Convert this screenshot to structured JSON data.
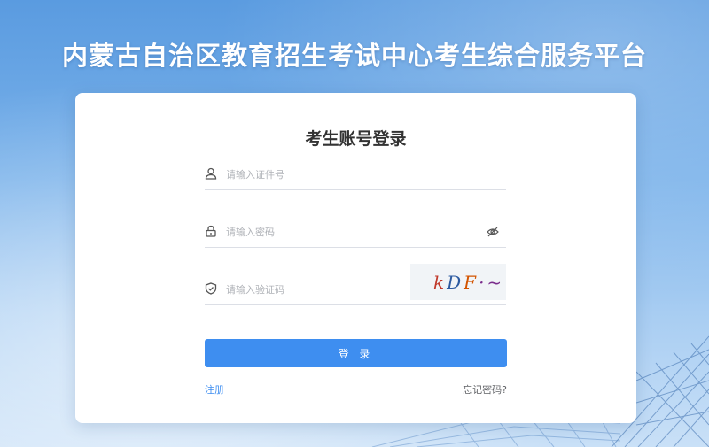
{
  "header": {
    "title": "内蒙古自治区教育招生考试中心考生综合服务平台"
  },
  "login_card": {
    "title": "考生账号登录",
    "id_field": {
      "placeholder": "请输入证件号",
      "value": ""
    },
    "password_field": {
      "placeholder": "请输入密码",
      "value": ""
    },
    "captcha_field": {
      "placeholder": "请输入验证码",
      "value": ""
    },
    "captcha": {
      "chars": [
        {
          "text": "k",
          "color": "#c0392b"
        },
        {
          "text": "D",
          "color": "#2c5aa0"
        },
        {
          "text": "F",
          "color": "#d35400"
        },
        {
          "text": "·~",
          "color": "#7a2d8c"
        }
      ]
    },
    "login_button": "登 录",
    "register_link": "注册",
    "forgot_link": "忘记密码?"
  },
  "colors": {
    "primary": "#3e8ef0",
    "background": "#6aa8e8"
  },
  "icons": [
    "user-icon",
    "lock-icon",
    "eye-slash-icon",
    "shield-check-icon"
  ]
}
